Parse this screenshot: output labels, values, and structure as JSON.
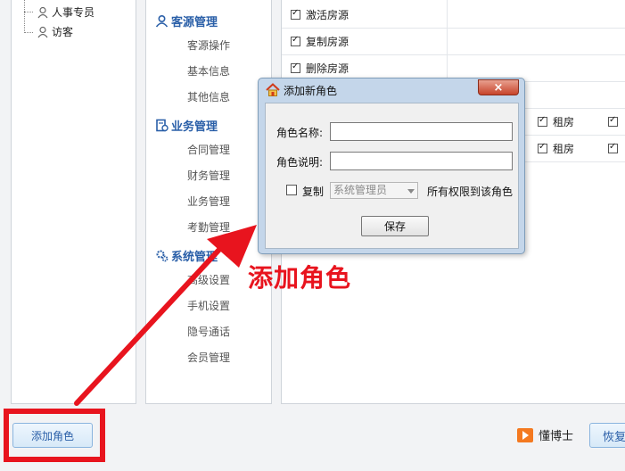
{
  "tree": {
    "items": [
      {
        "label": "人事专员"
      },
      {
        "label": "访客"
      }
    ]
  },
  "menu": {
    "groups": [
      {
        "title": "客源管理",
        "icon": "customer-icon",
        "items": [
          "客源操作",
          "基本信息",
          "其他信息"
        ]
      },
      {
        "title": "业务管理",
        "icon": "business-icon",
        "items": [
          "合同管理",
          "财务管理",
          "业务管理",
          "考勤管理"
        ]
      },
      {
        "title": "系统管理",
        "icon": "gears-icon",
        "items": [
          "高级设置",
          "手机设置",
          "隐号通话",
          "会员管理"
        ]
      }
    ]
  },
  "permissions": {
    "rows": [
      {
        "label": "激活房源",
        "checked": true
      },
      {
        "label": "复制房源",
        "checked": true
      },
      {
        "label": "删除房源",
        "checked": true
      }
    ],
    "right_rows": [
      {
        "label": "租房",
        "checked": true
      },
      {
        "label": "租房",
        "checked": true
      }
    ]
  },
  "dialog": {
    "title": "添加新角色",
    "close_glyph": "×",
    "role_name_label": "角色名称:",
    "role_desc_label": "角色说明:",
    "copy_label": "复制",
    "copy_source": "系统管理员",
    "copy_suffix": "所有权限到该角色",
    "save_label": "保存"
  },
  "bottom": {
    "add_role_label": "添加角色",
    "brand": "懂博士",
    "restore_label": "恢复"
  },
  "annotation": {
    "text": "添加角色",
    "color": "#e8141e"
  }
}
